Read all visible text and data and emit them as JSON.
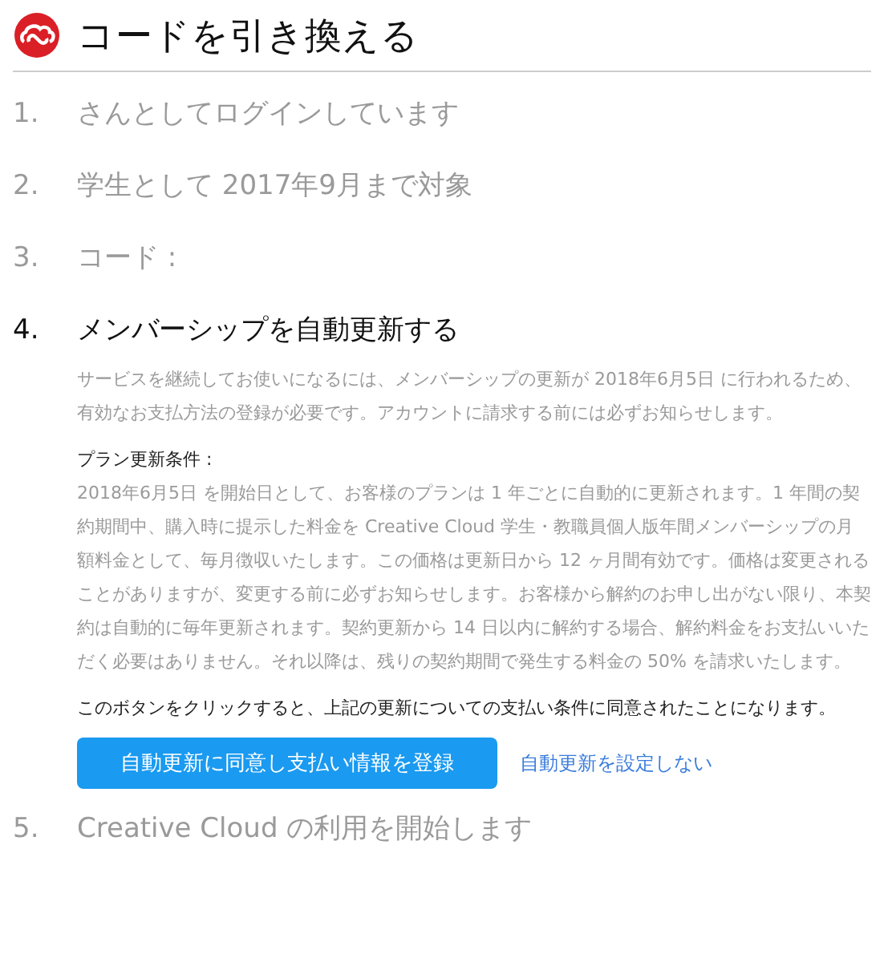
{
  "header": {
    "title": "コードを引き換える"
  },
  "steps": [
    {
      "number": "1.",
      "title": "さんとしてログインしています",
      "active": false
    },
    {
      "number": "2.",
      "title": "学生として 2017年9月まで対象",
      "active": false
    },
    {
      "number": "3.",
      "title": "コード :",
      "active": false
    },
    {
      "number": "4.",
      "title": "メンバーシップを自動更新する",
      "active": true,
      "details": {
        "description": "サービスを継続してお使いになるには、メンバーシップの更新が 2018年6月5日 に行われるため、有効なお支払方法の登録が必要です。アカウントに請求する前には必ずお知らせします。",
        "terms_heading": "プラン更新条件 :",
        "terms_text": "2018年6月5日 を開始日として、お客様のプランは 1 年ごとに自動的に更新されます。1 年間の契約期間中、購入時に提示した料金を Creative Cloud 学生・教職員個人版年間メンバーシップの月額料金として、毎月徴収いたします。この価格は更新日から 12 ヶ月間有効です。価格は変更されることがありますが、変更する前に必ずお知らせします。お客様から解約のお申し出がない限り、本契約は自動的に毎年更新されます。契約更新から 14 日以内に解約する場合、解約料金をお支払いいただく必要はありません。それ以降は、残りの契約期間で発生する料金の 50% を請求いたします。",
        "consent_text": "このボタンをクリックすると、上記の更新についての支払い条件に同意されたことになります。",
        "primary_button": "自動更新に同意し支払い情報を登録",
        "secondary_link": "自動更新を設定しない"
      }
    },
    {
      "number": "5.",
      "title": "Creative Cloud の利用を開始します",
      "active": false
    }
  ]
}
